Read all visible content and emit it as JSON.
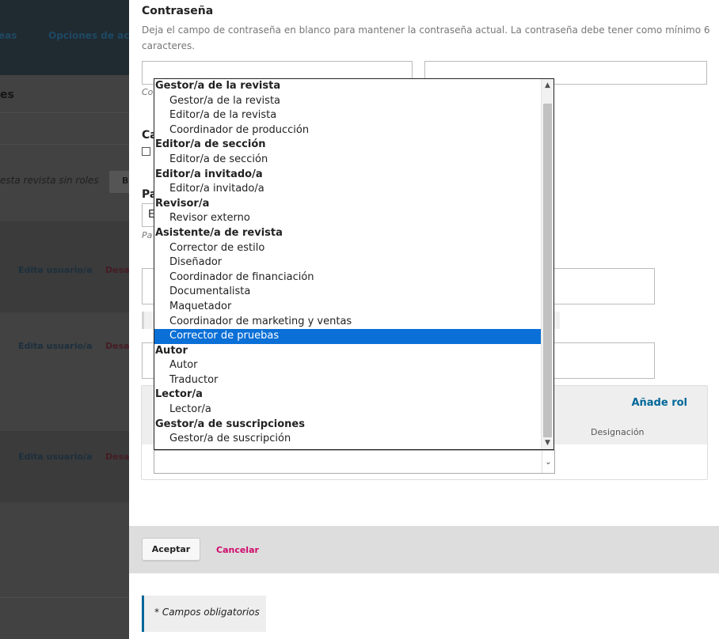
{
  "background": {
    "nav_items": [
      "eas",
      "Opciones de acceso"
    ],
    "page_title_fragment": "es",
    "no_roles_text": "esta revista sin roles",
    "button_fragment": "B",
    "rows": [
      {
        "edit_label": "Edita usuario/a",
        "disable_label": "Desac"
      },
      {
        "edit_label": "Edita usuario/a",
        "disable_label": "Desac"
      },
      {
        "edit_label": "Edita usuario/a",
        "disable_label": "Desac"
      }
    ]
  },
  "modal": {
    "password": {
      "label": "Contraseña",
      "description": "Deja el campo de contraseña en blanco para mantener la contraseña actual. La contraseña debe tener como mínimo 6 caracteres.",
      "hint_fragment": "Co"
    },
    "partial_labels": {
      "change_fragment": "Ca",
      "language_fragment": "Pa",
      "language_value_fragment": "E",
      "language_hint_fragment": "Pa"
    },
    "roles": {
      "add_role": "Añade rol",
      "designation_header": "Designación"
    },
    "role_select": {
      "groups": [
        {
          "label": "Gestor/a de la revista",
          "options": [
            "Gestor/a de la revista",
            "Editor/a de la revista",
            "Coordinador de producción"
          ]
        },
        {
          "label": "Editor/a de sección",
          "options": [
            "Editor/a de sección"
          ]
        },
        {
          "label": "Editor/a invitado/a",
          "options": [
            "Editor/a invitado/a"
          ]
        },
        {
          "label": "Revisor/a",
          "options": [
            "Revisor externo"
          ]
        },
        {
          "label": "Asistente/a de revista",
          "options": [
            "Corrector de estilo",
            "Diseñador",
            "Coordinador de financiación",
            "Documentalista",
            "Maquetador",
            "Coordinador de marketing y ventas",
            "Corrector de pruebas"
          ]
        },
        {
          "label": "Autor",
          "options": [
            "Autor",
            "Traductor"
          ]
        },
        {
          "label": "Lector/a",
          "options": [
            "Lector/a"
          ]
        },
        {
          "label": "Gestor/a de suscripciones",
          "options": [
            "Gestor/a de suscripción"
          ]
        }
      ],
      "selected": "Corrector de pruebas"
    },
    "footer": {
      "accept": "Aceptar",
      "cancel": "Cancelar"
    },
    "required_note": "* Campos obligatorios"
  },
  "icons": {
    "scroll_up": "triangle-up",
    "scroll_down": "triangle-down",
    "select_arrow": "chevron-down"
  },
  "colors": {
    "selection": "#0a6fd6",
    "link": "#006798",
    "cancel": "#d00a6c"
  }
}
